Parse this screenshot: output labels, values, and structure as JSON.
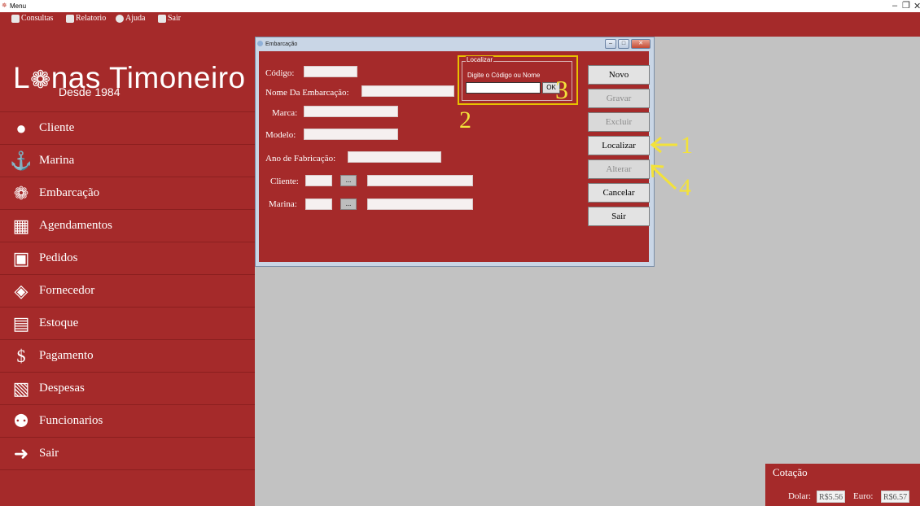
{
  "window": {
    "title": "Menu"
  },
  "menubar": {
    "items": [
      {
        "label": "Consultas",
        "icon": "consultas-icon"
      },
      {
        "label": "Relatorio",
        "icon": "report-icon"
      },
      {
        "label": "Ajuda",
        "icon": "help-icon"
      },
      {
        "label": "Sair",
        "icon": "exit-icon"
      }
    ]
  },
  "brand": {
    "logo_prefix": "L",
    "logo_icon": "ship-wheel-icon",
    "logo_suffix": "nas Timoneiro",
    "tagline": "Desde 1984"
  },
  "sidebar": {
    "items": [
      {
        "label": "Cliente",
        "icon": "user-icon"
      },
      {
        "label": "Marina",
        "icon": "anchor-icon"
      },
      {
        "label": "Embarcação",
        "icon": "ship-wheel-icon"
      },
      {
        "label": "Agendamentos",
        "icon": "calendar-icon"
      },
      {
        "label": "Pedidos",
        "icon": "orders-icon"
      },
      {
        "label": "Fornecedor",
        "icon": "supplier-icon"
      },
      {
        "label": "Estoque",
        "icon": "stock-icon"
      },
      {
        "label": "Pagamento",
        "icon": "payment-icon"
      },
      {
        "label": "Despesas",
        "icon": "expenses-icon"
      },
      {
        "label": "Funcionarios",
        "icon": "employees-icon"
      },
      {
        "label": "Sair",
        "icon": "exit-icon"
      }
    ]
  },
  "dialog": {
    "title": "Embarcação",
    "fields": {
      "codigo": {
        "label": "Código:",
        "value": ""
      },
      "nome": {
        "label": "Nome Da Embarcação:",
        "value": ""
      },
      "marca": {
        "label": "Marca:",
        "value": ""
      },
      "modelo": {
        "label": "Modelo:",
        "value": ""
      },
      "ano": {
        "label": "Ano de Fabricação:",
        "value": ""
      },
      "cliente": {
        "label": "Cliente:",
        "value": "",
        "lookup": "...",
        "name": ""
      },
      "marina": {
        "label": "Marina:",
        "value": "",
        "lookup": "...",
        "name": ""
      }
    },
    "localizar": {
      "legend": "Localizar",
      "hint": "Digite o Código ou Nome",
      "value": "",
      "ok": "OK"
    },
    "buttons": {
      "novo": "Novo",
      "gravar": "Gravar",
      "excluir": "Excluir",
      "localizar": "Localizar",
      "alterar": "Alterar",
      "cancelar": "Cancelar",
      "sair": "Sair"
    }
  },
  "annotations": {
    "n1": "1",
    "n2": "2",
    "n3": "3",
    "n4": "4"
  },
  "cotacao": {
    "title": "Cotação",
    "dolar_label": "Dolar:",
    "dolar_value": "R$5.56",
    "euro_label": "Euro:",
    "euro_value": "R$6.57"
  },
  "colors": {
    "brand": "#a52a2a",
    "workspace": "#c2c2c2",
    "annotation": "#f3e23a"
  }
}
